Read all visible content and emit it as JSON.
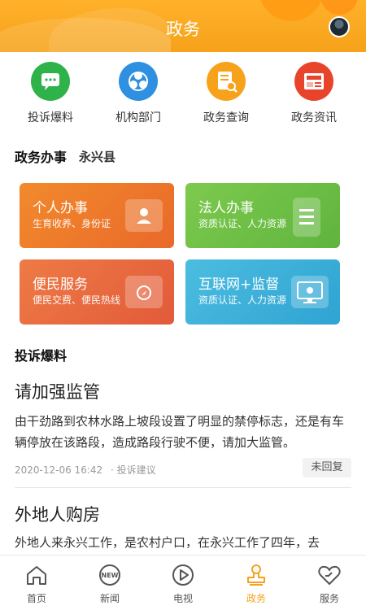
{
  "header": {
    "title": "政务"
  },
  "quick_actions": [
    {
      "label": "投诉爆料",
      "icon": "chat-bubble-icon",
      "color": "#2fb24a"
    },
    {
      "label": "机构部门",
      "icon": "org-circles-icon",
      "color": "#2f8fe0"
    },
    {
      "label": "政务查询",
      "icon": "document-search-icon",
      "color": "#f7a21b"
    },
    {
      "label": "政务资讯",
      "icon": "news-icon",
      "color": "#e8442c"
    }
  ],
  "affairs": {
    "title": "政务办事",
    "county": "永兴县",
    "cards": [
      {
        "title": "个人办事",
        "sub": "生育收养、身份证",
        "color": "#f07b2a"
      },
      {
        "title": "法人办事",
        "sub": "资质认证、人力资源",
        "color": "#71c04a"
      },
      {
        "title": "便民服务",
        "sub": "便民交费、便民热线",
        "color": "#ea6b3f"
      },
      {
        "title": "互联网+监督",
        "sub": "资质认证、人力资源",
        "color": "#3fb0d8"
      }
    ]
  },
  "complaints": {
    "title": "投诉爆料",
    "items": [
      {
        "title": "请加强监管",
        "body": "由干劲路到农林水路上坡段设置了明显的禁停标志，还是有车辆停放在该路段，造成路段行驶不便，请加大监管。",
        "date": "2020-12-06 16:42",
        "category": "投诉建议",
        "status": "未回复"
      },
      {
        "title": "外地人购房",
        "body": "外地人来永兴工作，是农村户口，在永兴工作了四年，去"
      }
    ]
  },
  "tabs": [
    {
      "label": "首页",
      "icon": "home-icon",
      "active": false
    },
    {
      "label": "新闻",
      "icon": "new-badge-icon",
      "active": false
    },
    {
      "label": "电视",
      "icon": "play-icon",
      "active": false
    },
    {
      "label": "政务",
      "icon": "stamp-icon",
      "active": true
    },
    {
      "label": "服务",
      "icon": "heart-icon",
      "active": false
    }
  ]
}
